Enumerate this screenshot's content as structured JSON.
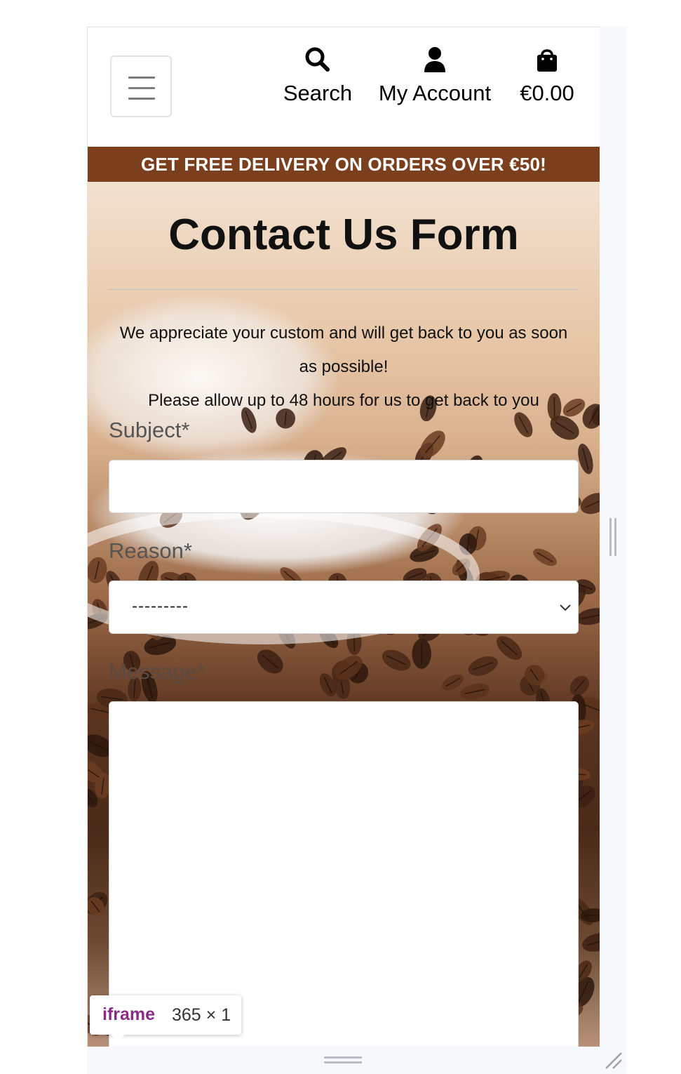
{
  "header": {
    "search_label": "Search",
    "account_label": "My Account",
    "cart_total": "€0.00"
  },
  "banner": {
    "text": "GET FREE DELIVERY ON ORDERS OVER €50!"
  },
  "page": {
    "title": "Contact Us Form",
    "intro_line1": "We appreciate your custom and will get back to you as soon as possible!",
    "intro_line2": "Please allow up to 48 hours for us to get back to you"
  },
  "form": {
    "subject_label": "Subject*",
    "subject_value": "",
    "reason_label": "Reason*",
    "reason_selected": "---------",
    "message_label": "Message*",
    "message_value": ""
  },
  "devtools": {
    "tooltip_tag": "iframe",
    "tooltip_dims": "365 × 1"
  },
  "colors": {
    "banner_bg": "#7b3f1d",
    "tooltip_tag": "#8a2c85"
  },
  "icons": [
    "hamburger-icon",
    "search-icon",
    "user-icon",
    "shopping-bag-icon",
    "chevron-down-icon",
    "resize-corner-icon"
  ]
}
